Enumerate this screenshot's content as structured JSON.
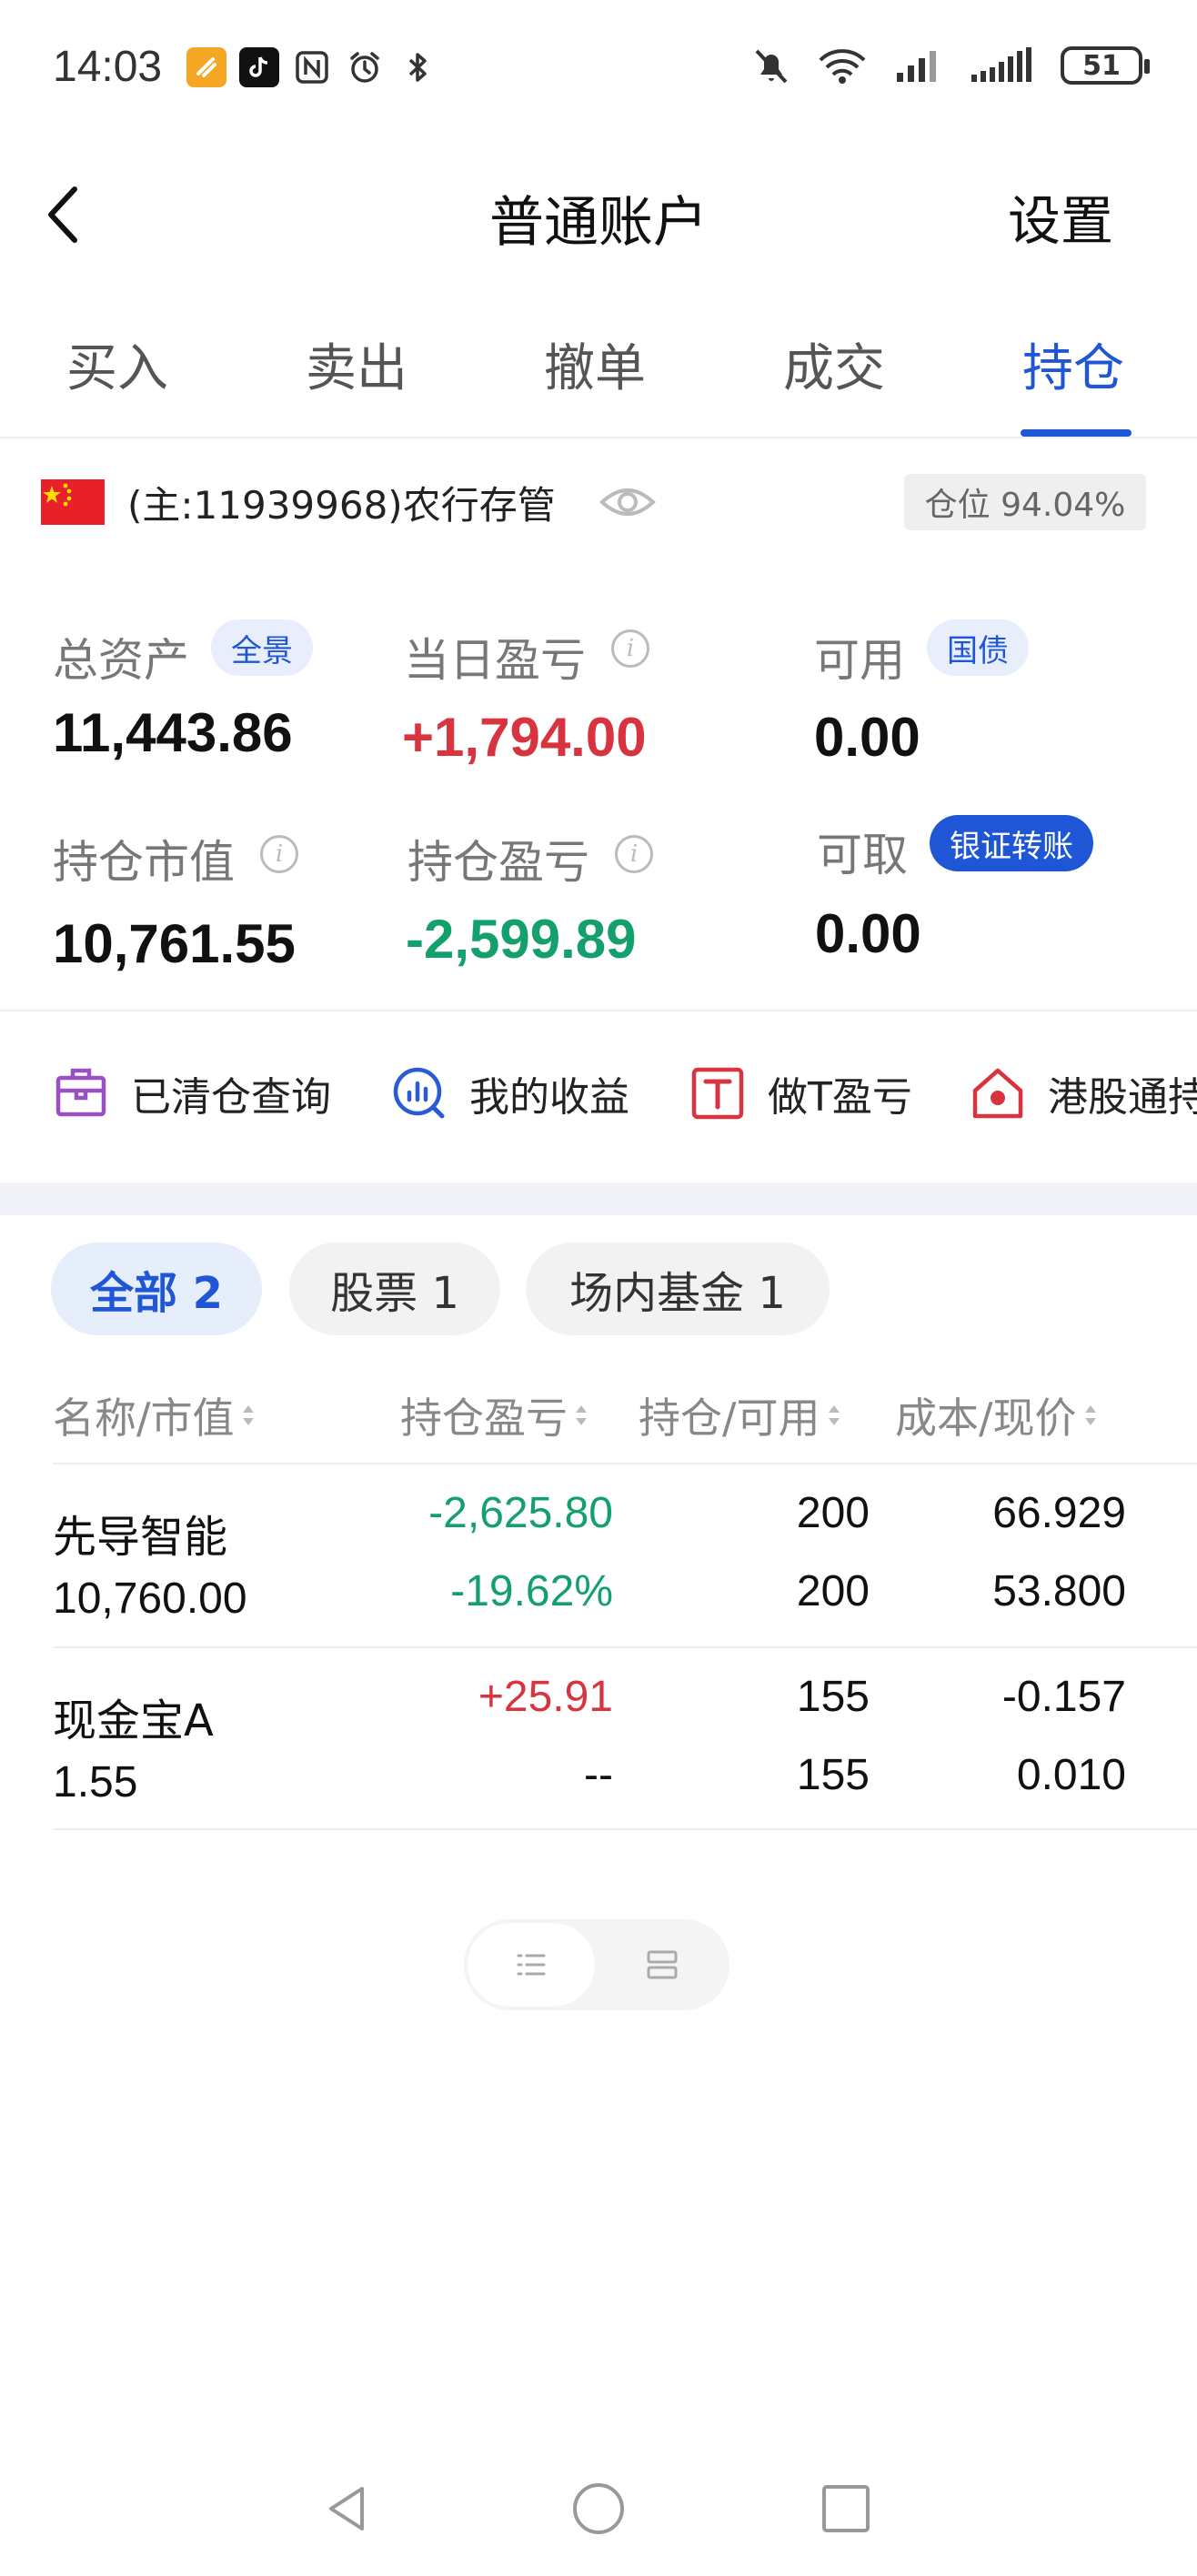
{
  "status": {
    "time": "14:03",
    "battery": "51"
  },
  "header": {
    "title": "普通账户",
    "settings_label": "设置"
  },
  "tabs": [
    {
      "label": "买入"
    },
    {
      "label": "卖出"
    },
    {
      "label": "撤单"
    },
    {
      "label": "成交"
    },
    {
      "label": "持仓",
      "active": true
    }
  ],
  "account": {
    "label": "(主:11939968)农行存管",
    "position_ratio": "仓位 94.04%"
  },
  "metrics": {
    "total_assets": {
      "label": "总资产",
      "value": "11,443.86",
      "tag": "全景"
    },
    "daily_pnl": {
      "label": "当日盈亏",
      "value": "+1,794.00"
    },
    "available": {
      "label": "可用",
      "value": "0.00",
      "tag": "国债"
    },
    "market_value": {
      "label": "持仓市值",
      "value": "10,761.55"
    },
    "position_pnl": {
      "label": "持仓盈亏",
      "value": "-2,599.89"
    },
    "withdrawable": {
      "label": "可取",
      "value": "0.00",
      "tag": "银证转账"
    }
  },
  "quick_links": [
    {
      "label": "已清仓查询",
      "icon": "briefcase-icon"
    },
    {
      "label": "我的收益",
      "icon": "chart-search-icon"
    },
    {
      "label": "做T盈亏",
      "icon": "t-box-icon"
    },
    {
      "label": "港股通持",
      "icon": "hk-house-icon"
    }
  ],
  "filters": [
    {
      "label": "全部 2",
      "active": true
    },
    {
      "label": "股票 1"
    },
    {
      "label": "场内基金 1"
    }
  ],
  "table": {
    "headers": [
      "名称/市值",
      "持仓盈亏",
      "持仓/可用",
      "成本/现价"
    ],
    "rows": [
      {
        "name": "先导智能",
        "market_value": "10,760.00",
        "pnl": "-2,625.80",
        "pnl_pct": "-19.62%",
        "holding": "200",
        "available": "200",
        "cost": "66.929",
        "price": "53.800"
      },
      {
        "name": "现金宝A",
        "market_value": "1.55",
        "pnl": "+25.91",
        "pnl_pct": "--",
        "holding": "155",
        "available": "155",
        "cost": "-0.157",
        "price": "0.010"
      }
    ]
  },
  "colors": {
    "accent": "#1f56d6",
    "gain": "#d8343f",
    "loss": "#14a06c"
  }
}
